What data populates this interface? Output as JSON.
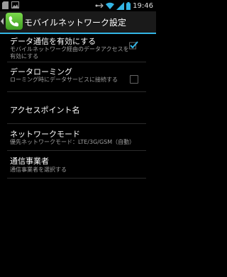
{
  "status_bar": {
    "time": "19:46",
    "icons": [
      "sd-card-icon",
      "image-icon",
      "usb-icon",
      "wifi-icon",
      "signal-icon",
      "battery-icon"
    ]
  },
  "action_bar": {
    "title": "モバイルネットワーク設定",
    "icon": "phone-settings-icon"
  },
  "settings": [
    {
      "title": "データ通信を有効にする",
      "summary": "モバイルネットワーク経由のデータアクセスを有効にする",
      "checked": true
    },
    {
      "title": "データローミング",
      "summary": "ローミング時にデータサービスに接続する",
      "checked": false
    },
    {
      "title": "アクセスポイント名"
    },
    {
      "title": "ネットワークモード",
      "summary": "優先ネットワークモード：LTE/3G/GSM（自動）"
    },
    {
      "title": "通信事業者",
      "summary": "通信事業者を選択する"
    }
  ],
  "colors": {
    "accent": "#33b5e5",
    "background": "#000000",
    "summary_text": "#9e9e9e"
  }
}
